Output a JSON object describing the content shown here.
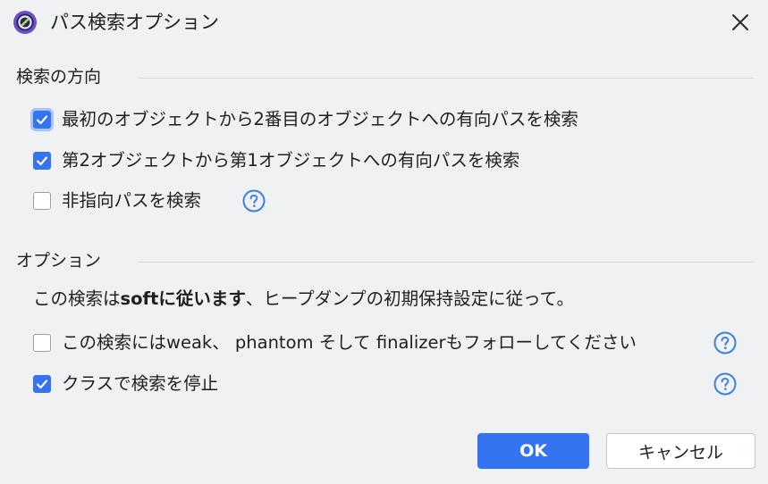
{
  "window": {
    "title": "パス検索オプション"
  },
  "sections": {
    "direction": {
      "header": "検索の方向",
      "options": [
        {
          "label": "最初のオブジェクトから2番目のオブジェクトへの有向パスを検索",
          "checked": true
        },
        {
          "label": "第2オブジェクトから第1オブジェクトへの有向パスを検索",
          "checked": true
        },
        {
          "label": "非指向パスを検索",
          "checked": false
        }
      ]
    },
    "options": {
      "header": "オプション",
      "info_prefix": "この検索は",
      "info_bold": "softに従います",
      "info_suffix": "、ヒープダンプの初期保持設定に従って。",
      "items": [
        {
          "label": "この検索にはweak、 phantom そして finalizerもフォローしてください",
          "checked": false
        },
        {
          "label": "クラスで検索を停止",
          "checked": true
        }
      ]
    }
  },
  "buttons": {
    "ok": "OK",
    "cancel": "キャンセル"
  },
  "colors": {
    "accent": "#3574f0",
    "background": "#f0f1f3",
    "help_icon": "#3b82e0"
  },
  "icons": {
    "app": "app-logo-icon",
    "close": "close-icon",
    "checkbox": "checkmark-icon",
    "help": "help-question-icon"
  }
}
